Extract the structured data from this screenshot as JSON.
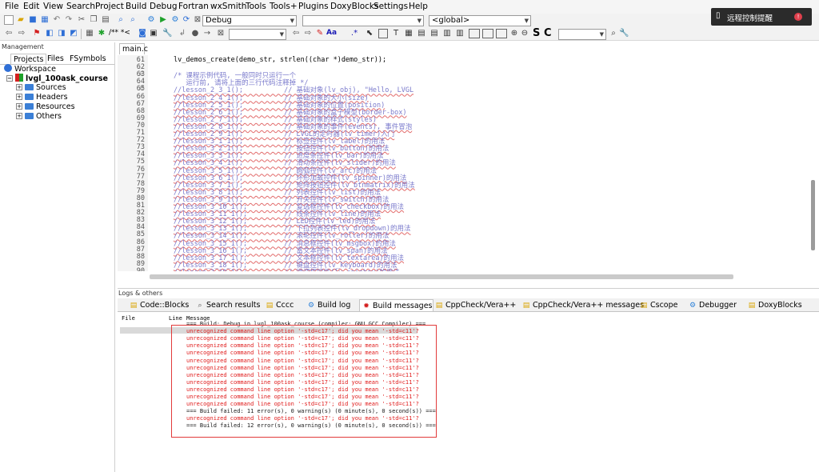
{
  "menubar": [
    "File",
    "Edit",
    "View",
    "Search",
    "Project",
    "Build",
    "Debug",
    "Fortran",
    "wxSmith",
    "Tools",
    "Tools+",
    "Plugins",
    "DoxyBlocks",
    "Settings",
    "Help"
  ],
  "toolbar": {
    "build_target": "Debug",
    "scope_combo": "<global>",
    "comment_label": "/** *<",
    "abbr_label": "Aa",
    "s_label": "S",
    "c_label": "C"
  },
  "notification": {
    "text": "远程控制提醒",
    "badge": "!"
  },
  "management": {
    "title": "Management",
    "tabs": [
      "Projects",
      "Files",
      "FSymbols"
    ],
    "tree": {
      "root": "Workspace",
      "project": "lvgl_100ask_course",
      "folders": [
        "Sources",
        "Headers",
        "Resources",
        "Others"
      ]
    }
  },
  "editor": {
    "tab": "main.c",
    "lines": [
      {
        "n": "61",
        "t": "lv_demos_create(demo_str, strlen((char *)demo_str));"
      },
      {
        "n": "62",
        "t": ""
      },
      {
        "n": "63",
        "t": "/* 课程示例代码, 一般同时只运行一个"
      },
      {
        "n": "64",
        "t": "   运行前, 请将上面的三行代码注释掉 */"
      },
      {
        "n": "65",
        "t": "//lesson_2_3_1();          // 基础对象(lv_obj), \"Hello, LVGL"
      },
      {
        "n": "66",
        "t": "//lesson_2_4_1();          // 基础对象的大小(size)"
      },
      {
        "n": "67",
        "t": "//lesson_2_5_1();          // 基础对象的位置(position)"
      },
      {
        "n": "68",
        "t": "//lesson_2_6_1();          // 基础对象的盒子模型(border-box)"
      },
      {
        "n": "69",
        "t": "//lesson_2_7_1();          // 基础对象的样式(styles)"
      },
      {
        "n": "70",
        "t": "//lesson_2_8_1();          // 基础对象的事件(events), 事件冒泡"
      },
      {
        "n": "71",
        "t": "//lesson_2_9_1();          // LVGL的定时器(lv_timer)入门"
      },
      {
        "n": "72",
        "t": "//lesson_3_1_1();          // 标签控件(lv_label)的用法"
      },
      {
        "n": "73",
        "t": "//lesson_3_2_1();          // 按钮控件(lv_button)的用法"
      },
      {
        "n": "74",
        "t": "//lesson_3_3_1();          // 进度条控件(lv_bar)的用法"
      },
      {
        "n": "75",
        "t": "//lesson_3_4_1();          // 滑动条控件(lv_slider)的用法"
      },
      {
        "n": "76",
        "t": "//lesson_3_5_1();          // 圆弧控件(lv_arc)的用法"
      },
      {
        "n": "77",
        "t": "//lesson_3_6_1();          // 环形加载控件(lv_spinner)的用法"
      },
      {
        "n": "78",
        "t": "//lesson_3_7_1();          // 矩阵按钮控件(lv_btnmatrix)的用法"
      },
      {
        "n": "79",
        "t": "//lesson_3_8_1();          // 列表控件(lv_list)的用法"
      },
      {
        "n": "80",
        "t": "//lesson_3_9_1();          // 开关控件(lv_switch)的用法"
      },
      {
        "n": "81",
        "t": "//lesson_3_10_1();         // 复选框控件(lv_checkbox)的用法"
      },
      {
        "n": "82",
        "t": "//lesson_3_11_1();         // 线条控件(lv_line)的用法"
      },
      {
        "n": "83",
        "t": "//lesson_3_12_1();         // LED控件(lv_led)的用法"
      },
      {
        "n": "84",
        "t": "//lesson_3_13_1();         // 下拉列表控件(lv_dropdown)的用法"
      },
      {
        "n": "85",
        "t": "//lesson_3_14_1();         // 滚轮控件(lv_roller)的用法"
      },
      {
        "n": "86",
        "t": "//lesson_3_15_1();         // 消息框控件(lv_msgbox)的用法"
      },
      {
        "n": "87",
        "t": "//lesson_3_16_1();         // 富文本控件(lv_span)的用法"
      },
      {
        "n": "88",
        "t": "//lesson_3_17_1();         // 文本框控件(lv_textarea)的用法"
      },
      {
        "n": "89",
        "t": "//lesson_3_18_1();         // 键盘控件(lv_keyboard)的用法"
      },
      {
        "n": "90",
        "t": "//lesson_3_19_1();         // 微调框控件(lv_spinbox)的用法"
      }
    ]
  },
  "logs": {
    "title": "Logs & others",
    "tabs": [
      "Code::Blocks",
      "Search results",
      "Cccc",
      "Build log",
      "Build messages",
      "CppCheck/Vera++",
      "CppCheck/Vera++ messages",
      "Cscope",
      "Debugger",
      "DoxyBlocks"
    ],
    "columns": [
      "File",
      "Line",
      "Message"
    ],
    "messages": [
      {
        "text": "=== Build: Debug in lvgl_100ask_course (compiler: GNU GCC Compiler) ===",
        "kind": "info"
      },
      {
        "text": "unrecognized command line option '-std=c17'; did you mean '-std=c11'?",
        "kind": "error"
      },
      {
        "text": "unrecognized command line option '-std=c17'; did you mean '-std=c11'?",
        "kind": "error"
      },
      {
        "text": "unrecognized command line option '-std=c17'; did you mean '-std=c11'?",
        "kind": "error"
      },
      {
        "text": "unrecognized command line option '-std=c17'; did you mean '-std=c11'?",
        "kind": "error"
      },
      {
        "text": "unrecognized command line option '-std=c17'; did you mean '-std=c11'?",
        "kind": "error"
      },
      {
        "text": "unrecognized command line option '-std=c17'; did you mean '-std=c11'?",
        "kind": "error"
      },
      {
        "text": "unrecognized command line option '-std=c17'; did you mean '-std=c11'?",
        "kind": "error"
      },
      {
        "text": "unrecognized command line option '-std=c17'; did you mean '-std=c11'?",
        "kind": "error"
      },
      {
        "text": "unrecognized command line option '-std=c17'; did you mean '-std=c11'?",
        "kind": "error"
      },
      {
        "text": "unrecognized command line option '-std=c17'; did you mean '-std=c11'?",
        "kind": "error"
      },
      {
        "text": "unrecognized command line option '-std=c17'; did you mean '-std=c11'?",
        "kind": "error"
      },
      {
        "text": "=== Build failed: 11 error(s), 0 warning(s) (0 minute(s), 0 second(s)) ===",
        "kind": "info"
      },
      {
        "text": "unrecognized command line option '-std=c17'; did you mean '-std=c11'?",
        "kind": "error"
      },
      {
        "text": "=== Build failed: 12 error(s), 0 warning(s) (0 minute(s), 0 second(s)) ===",
        "kind": "info"
      }
    ]
  },
  "colors": {
    "error_text": "#e01a1a",
    "comment": "#7a7acc",
    "keyword": "#1a1ab5",
    "accent_blue": "#2f6fd6",
    "highlight_box": "#e23b3b"
  }
}
